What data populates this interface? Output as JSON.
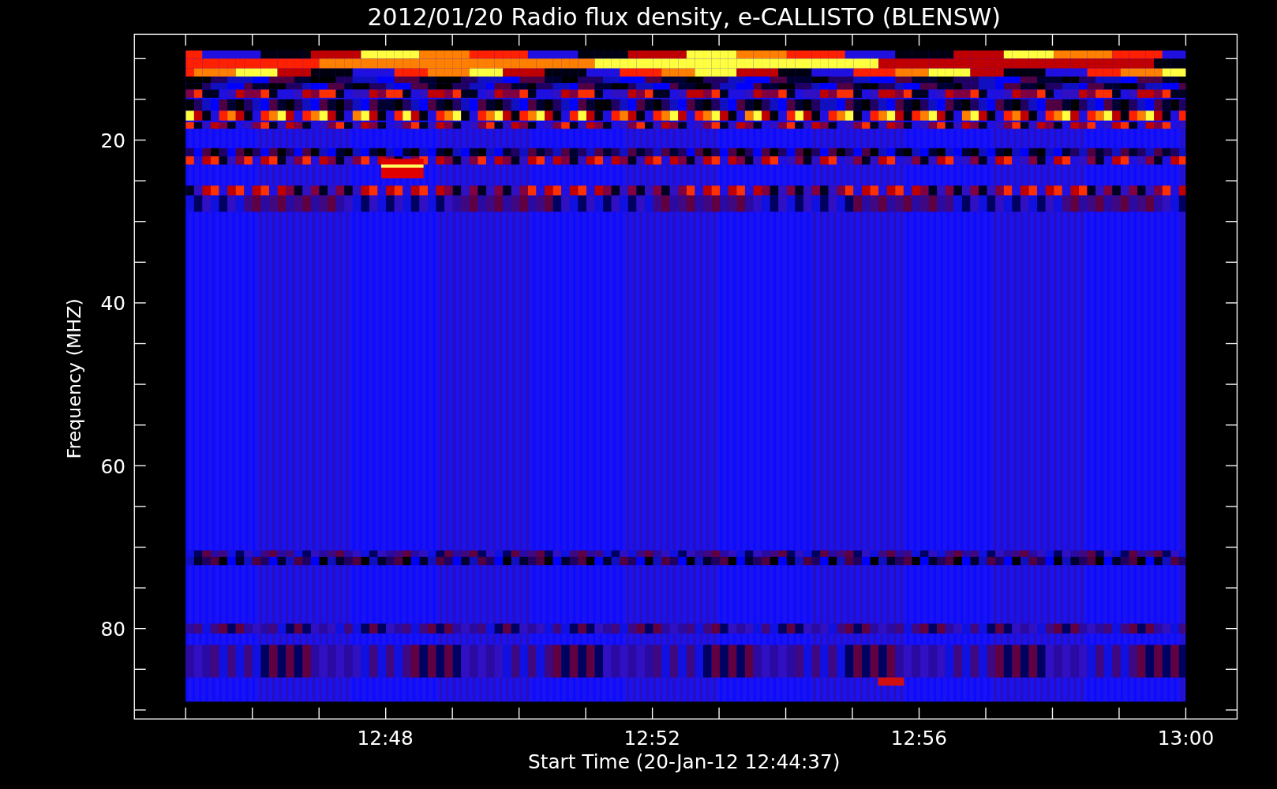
{
  "title": "2012/01/20  Radio flux density, e-CALLISTO (BLENSW)",
  "y_axis": {
    "label": "Frequency (MHZ)",
    "tick_labels": [
      "20",
      "40",
      "60",
      "80"
    ]
  },
  "x_axis": {
    "label": "Start Time (20-Jan-12 12:44:37)",
    "tick_labels": [
      "12:48",
      "12:52",
      "12:56",
      "13:00"
    ]
  }
}
